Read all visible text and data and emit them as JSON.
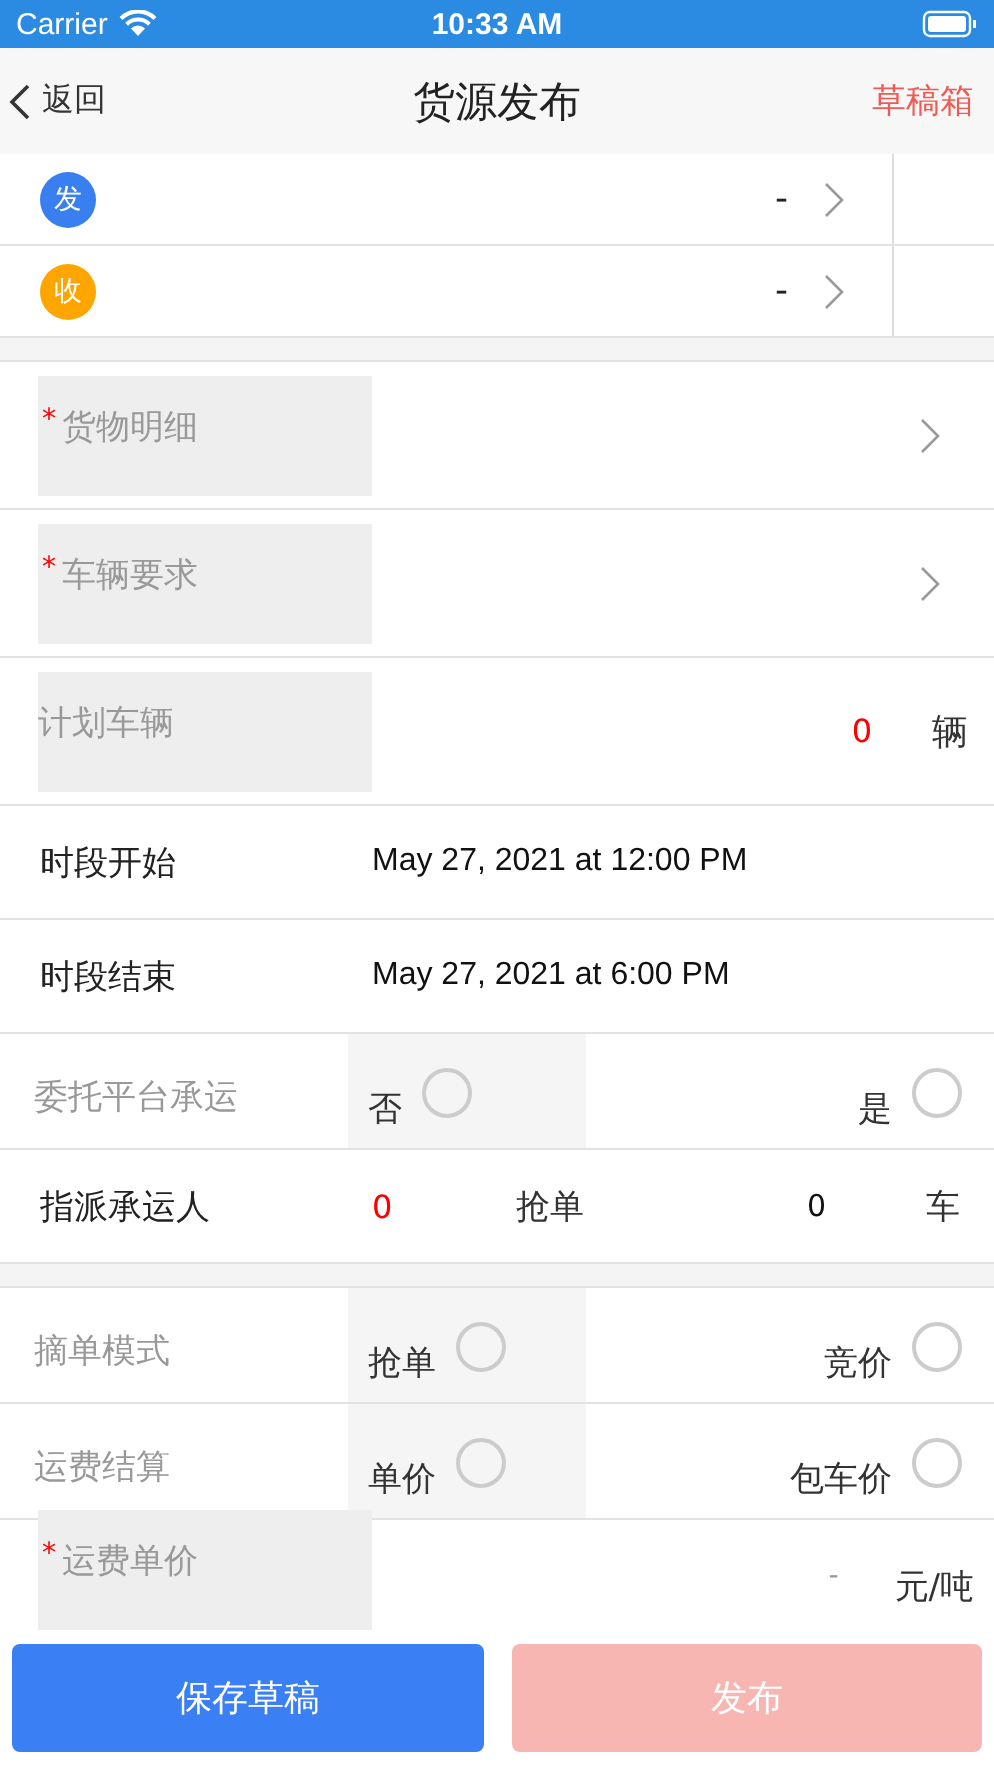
{
  "status_bar": {
    "carrier": "Carrier",
    "time": "10:33 AM"
  },
  "nav": {
    "back": "返回",
    "title": "货源发布",
    "action": "草稿箱"
  },
  "route": [
    {
      "badge": "发",
      "color": "#3a7ff0",
      "value": "-"
    },
    {
      "badge": "收",
      "color": "#ffa500",
      "value": "-"
    }
  ],
  "sections": [
    {
      "fields": [
        {
          "kind": "select",
          "label": "货物明细",
          "mark": "*"
        },
        {
          "kind": "select",
          "label": "车辆要求",
          "mark": "*"
        },
        {
          "kind": "count",
          "label": "计划车辆",
          "value": "0",
          "unit": "辆"
        },
        {
          "kind": "time",
          "label": "时段开始",
          "value": "May 27, 2021 at 12:00 PM"
        },
        {
          "kind": "time",
          "label": "时段结束",
          "value": "May 27, 2021 at 6:00 PM"
        },
        {
          "kind": "choice",
          "label": "委托平台承运",
          "options": [
            {
              "label": "否",
              "selected": false
            },
            {
              "label": "是",
              "selected": false
            }
          ]
        },
        {
          "kind": "assign",
          "label": "指派承运人",
          "value": "0",
          "mode": "抢单",
          "count": "0",
          "unit": "车"
        }
      ]
    },
    {
      "fields": [
        {
          "kind": "choice",
          "label": "摘单模式",
          "options": [
            {
              "label": "抢单",
              "selected": false
            },
            {
              "label": "竞价",
              "selected": false
            }
          ]
        },
        {
          "kind": "choice",
          "label": "运费结算",
          "options": [
            {
              "label": "单价",
              "selected": false
            },
            {
              "label": "包车价",
              "selected": false
            }
          ]
        },
        {
          "kind": "price",
          "label": "运费单价",
          "mark": "*",
          "placeholder": "-",
          "unit": "元/吨"
        }
      ]
    }
  ],
  "buttons": [
    {
      "label": "保存草稿",
      "disabled": false
    },
    {
      "label": "发布",
      "disabled": true
    }
  ]
}
